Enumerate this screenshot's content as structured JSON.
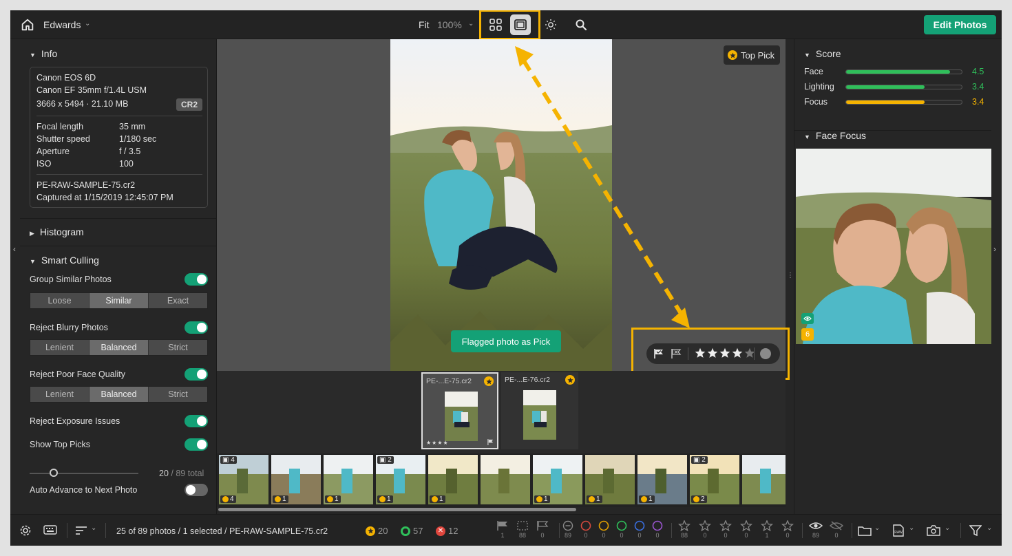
{
  "topbar": {
    "library": "Edwards",
    "fit": "Fit",
    "zoom": "100%",
    "edit_button": "Edit Photos"
  },
  "info": {
    "header": "Info",
    "camera": "Canon EOS 6D",
    "lens": "Canon EF 35mm f/1.4L USM",
    "dims": "3666 x 5494 · 21.10 MB",
    "format": "CR2",
    "specs": [
      {
        "k": "Focal length",
        "v": "35 mm"
      },
      {
        "k": "Shutter speed",
        "v": "1/180 sec"
      },
      {
        "k": "Aperture",
        "v": "f / 3.5"
      },
      {
        "k": "ISO",
        "v": "100"
      }
    ],
    "filename": "PE-RAW-SAMPLE-75.cr2",
    "captured": "Captured at 1/15/2019 12:45:07 PM"
  },
  "histogram": {
    "header": "Histogram"
  },
  "culling": {
    "header": "Smart Culling",
    "group_similar": "Group Similar Photos",
    "group_opts": [
      "Loose",
      "Similar",
      "Exact"
    ],
    "reject_blurry": "Reject Blurry Photos",
    "blurry_opts": [
      "Lenient",
      "Balanced",
      "Strict"
    ],
    "reject_face": "Reject Poor Face Quality",
    "face_opts": [
      "Lenient",
      "Balanced",
      "Strict"
    ],
    "reject_exposure": "Reject Exposure Issues",
    "show_top": "Show Top Picks",
    "top_count": "20",
    "top_total": " / 89 total",
    "top_slider_fraction": 0.22,
    "auto_advance": "Auto Advance to Next Photo"
  },
  "viewer": {
    "top_pick": "Top Pick",
    "toast": "Flagged photo as Pick",
    "rating": 4
  },
  "filmstrip": {
    "cards": [
      {
        "name": "PE-...E-75.cr2",
        "stars": "★★★★"
      },
      {
        "name": "PE-...E-76.cr2",
        "stars": ""
      }
    ],
    "thumbs": [
      {
        "badge": "4",
        "group": "4"
      },
      {
        "badge": "1",
        "group": ""
      },
      {
        "badge": "1",
        "group": ""
      },
      {
        "badge": "1",
        "group": "2"
      },
      {
        "badge": "1",
        "group": ""
      },
      {
        "badge": "",
        "group": ""
      },
      {
        "badge": "1",
        "group": ""
      },
      {
        "badge": "1",
        "group": ""
      },
      {
        "badge": "1",
        "group": ""
      },
      {
        "badge": "2",
        "group": "2"
      },
      {
        "badge": "",
        "group": ""
      }
    ]
  },
  "score": {
    "header": "Score",
    "rows": [
      {
        "label": "Face",
        "value": "4.5",
        "fraction": 0.9,
        "color": "#2fbf5a"
      },
      {
        "label": "Lighting",
        "value": "3.4",
        "fraction": 0.68,
        "color": "#2fbf5a"
      },
      {
        "label": "Focus",
        "value": "3.4",
        "fraction": 0.68,
        "color": "#f5b301"
      }
    ]
  },
  "face_focus": {
    "header": "Face Focus",
    "count": "6"
  },
  "bottom": {
    "status": "25 of 89 photos / 1 selected / PE-RAW-SAMPLE-75.cr2",
    "top_picks": "20",
    "accepted": "57",
    "rejected": "12",
    "flag_counts": [
      "1",
      "88",
      "0"
    ],
    "color_counts": [
      "89",
      "0",
      "0",
      "0",
      "0",
      "0"
    ],
    "star_counts": [
      "88",
      "0",
      "0",
      "0",
      "1",
      "0"
    ],
    "eye_counts": [
      "89",
      "0"
    ]
  }
}
